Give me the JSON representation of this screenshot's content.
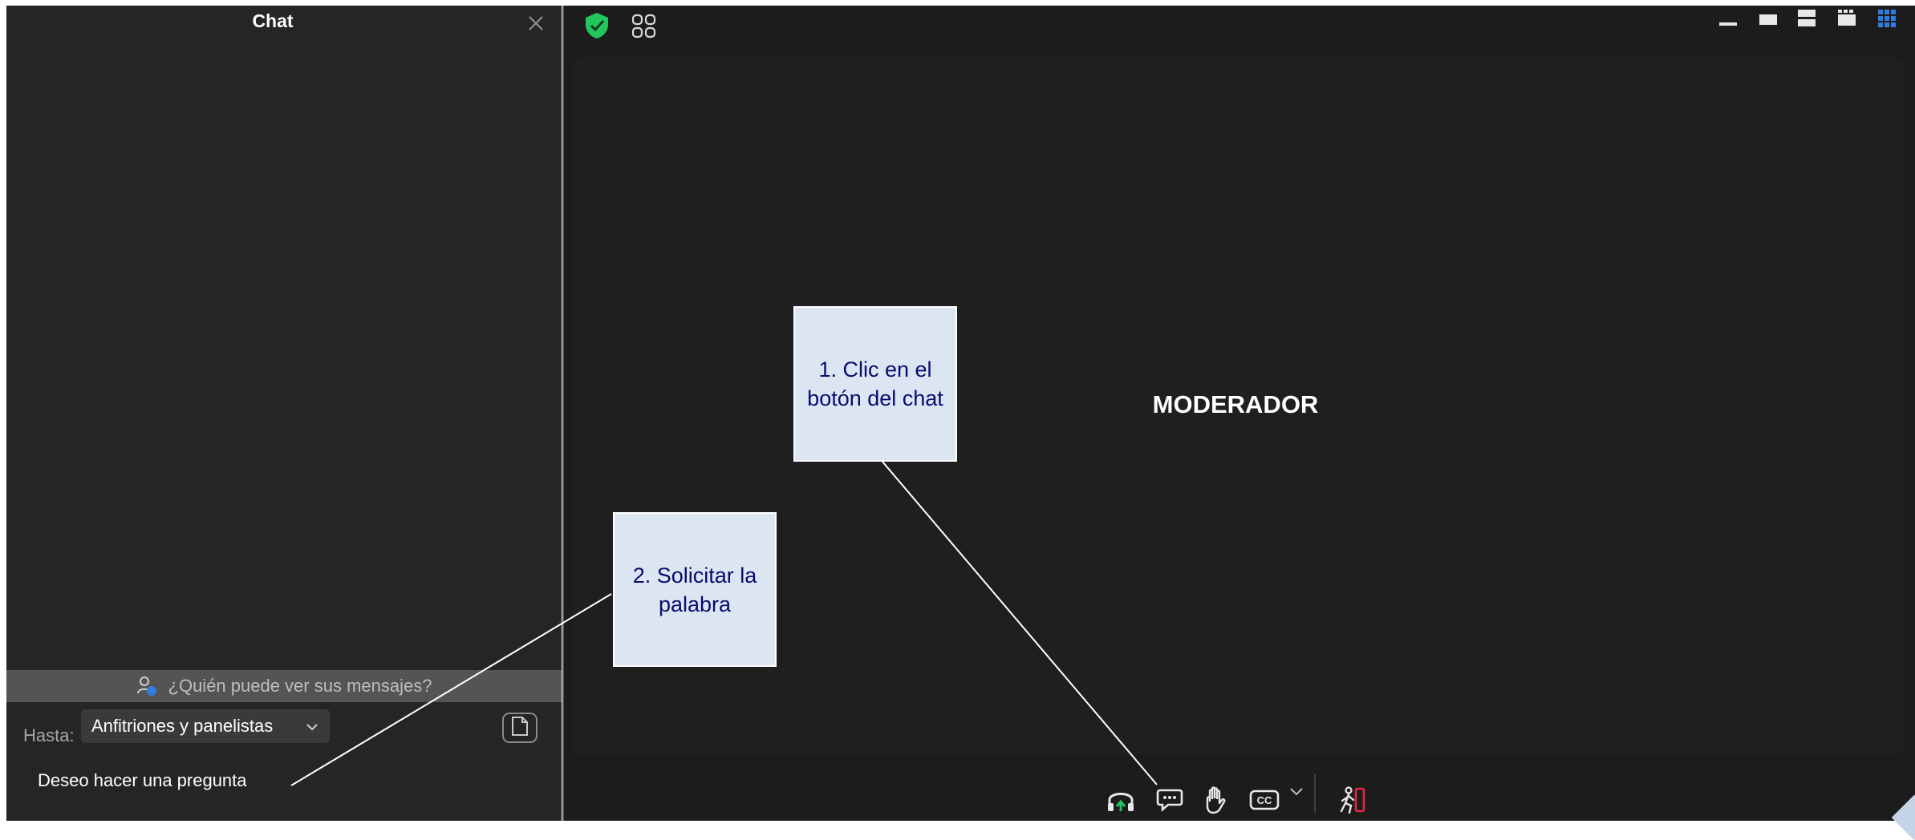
{
  "chat_panel": {
    "title": "Chat",
    "privacy_notice": "¿Quién puede ver sus mensajes?",
    "to_label": "Hasta:",
    "recipient_selected": "Anfitriones y panelistas",
    "message_text": "Deseo hacer una pregunta"
  },
  "meeting": {
    "participant_name": "MODERADOR"
  },
  "toolbar": {
    "icons": [
      "audio-headset-icon",
      "chat-icon",
      "raise-hand-icon",
      "closed-captions-icon",
      "chevron-down-icon",
      "leave-meeting-icon"
    ]
  },
  "callouts": {
    "step1": "1. Clic en el botón del chat",
    "step2": "2. Solicitar la palabra"
  },
  "colors": {
    "panel_bg": "#252525",
    "meeting_bg": "#1c1c1c",
    "shield_green": "#22c55e",
    "leave_red": "#e0294a",
    "view_active_blue": "#2f7de1",
    "callout_bg": "#dce6f2",
    "callout_text": "#0a0a6e"
  }
}
